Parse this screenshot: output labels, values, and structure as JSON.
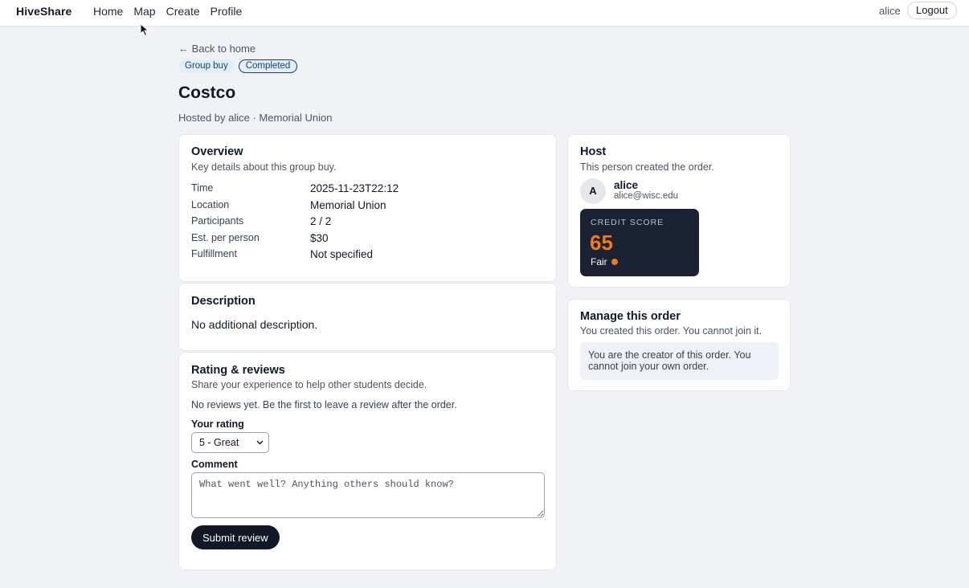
{
  "nav": {
    "brand": "HiveShare",
    "links": [
      "Home",
      "Map",
      "Create",
      "Profile"
    ],
    "user": "alice",
    "logout_label": "Logout"
  },
  "page": {
    "back_label": "← Back to home",
    "badges": {
      "type": "Group buy",
      "status": "Completed"
    },
    "title": "Costco",
    "subtitle": "Hosted by alice · Memorial Union"
  },
  "overview": {
    "title": "Overview",
    "subtitle": "Key details about this group buy.",
    "rows": [
      {
        "label": "Time",
        "value": "2025-11-23T22:12"
      },
      {
        "label": "Location",
        "value": "Memorial Union"
      },
      {
        "label": "Participants",
        "value": "2 / 2"
      },
      {
        "label": "Est. per person",
        "value": "$30"
      },
      {
        "label": "Fulfillment",
        "value": "Not specified"
      }
    ]
  },
  "description": {
    "title": "Description",
    "text": "No additional description."
  },
  "reviews": {
    "title": "Rating & reviews",
    "subtitle": "Share your experience to help other students decide.",
    "empty_text": "No reviews yet. Be the first to leave a review after the order.",
    "rating_label": "Your rating",
    "rating_value": "5 - Great",
    "comment_label": "Comment",
    "comment_placeholder": "What went well? Anything others should know?",
    "submit_label": "Submit review"
  },
  "host": {
    "title": "Host",
    "subtitle": "This person created the order.",
    "avatar_initial": "A",
    "name": "alice",
    "email": "alice@wisc.edu",
    "credit": {
      "label": "CREDIT SCORE",
      "score": "65",
      "level": "Fair"
    }
  },
  "manage": {
    "title": "Manage this order",
    "subtitle": "You created this order. You cannot join it.",
    "note": "You are the creator of this order. You cannot join your own order."
  },
  "colors": {
    "accent_dark": "#111827",
    "credit_orange": "#f27a1a",
    "credit_bg": "#1a2233",
    "badge_bg": "#e0effb"
  }
}
